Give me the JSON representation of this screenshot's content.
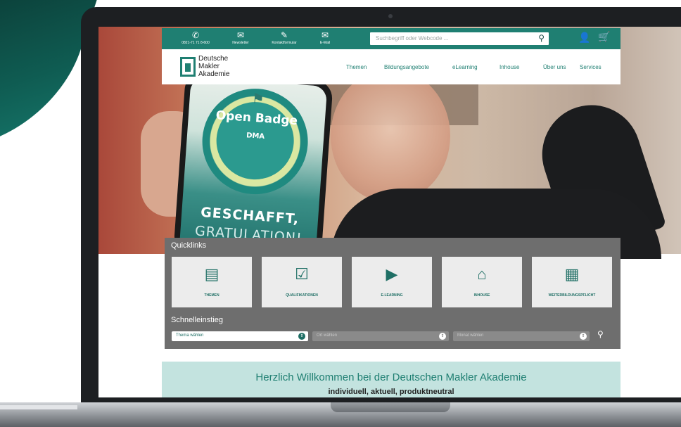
{
  "topbar": {
    "items": [
      {
        "icon": "phone-icon",
        "glyph": "✆",
        "label": "0821-71 71 8-600"
      },
      {
        "icon": "newsletter-icon",
        "glyph": "✉",
        "label": "Newsletter"
      },
      {
        "icon": "contact-form-icon",
        "glyph": "✎",
        "label": "Kontaktformular"
      },
      {
        "icon": "email-icon",
        "glyph": "✉",
        "label": "E-Mail"
      }
    ],
    "search_placeholder": "Suchbegriff oder Webcode ...",
    "search_glyph": "⚲",
    "user_glyph": "👤",
    "cart_glyph": "🛒"
  },
  "logo": {
    "line1": "Deutsche",
    "line2": "Makler",
    "line3": "Akademie"
  },
  "nav": [
    "Themen",
    "Bildungsangebote",
    "eLearning",
    "Inhouse",
    "Über uns",
    "Services"
  ],
  "hero_phone": {
    "badge_title": "Open Badge",
    "badge_sub": "DMA",
    "badge_glyph": "⚑",
    "line1": "GESCHAFFT,",
    "line2": "GRATULATION!"
  },
  "quicklinks": {
    "title": "Quicklinks",
    "tiles": [
      {
        "icon": "documents-icon",
        "glyph": "▤",
        "label": "THEMEN"
      },
      {
        "icon": "checklist-icon",
        "glyph": "☑",
        "label": "QUALIFIKATIONEN"
      },
      {
        "icon": "video-icon",
        "glyph": "▶",
        "label": "E-LEARNING"
      },
      {
        "icon": "house-icon",
        "glyph": "⌂",
        "label": "INHOUSE"
      },
      {
        "icon": "certificate-icon",
        "glyph": "▦",
        "label": "WEITERBILDUNGSPFLICHT"
      }
    ]
  },
  "schnelleinstieg": {
    "title": "Schnelleinstieg",
    "selects": [
      "Thema wählen",
      "Ort wählen",
      "Monat wählen"
    ],
    "arrow_glyph": "⇕",
    "search_glyph": "⚲"
  },
  "welcome": {
    "title": "Herzlich Willkommen bei der Deutschen Makler Akademie",
    "subtitle": "individuell, aktuell, produktneutral"
  },
  "colors": {
    "brand_teal": "#1f7f72",
    "panel_gray": "#6e6e6e",
    "welcome_bg": "#c3e3df"
  }
}
